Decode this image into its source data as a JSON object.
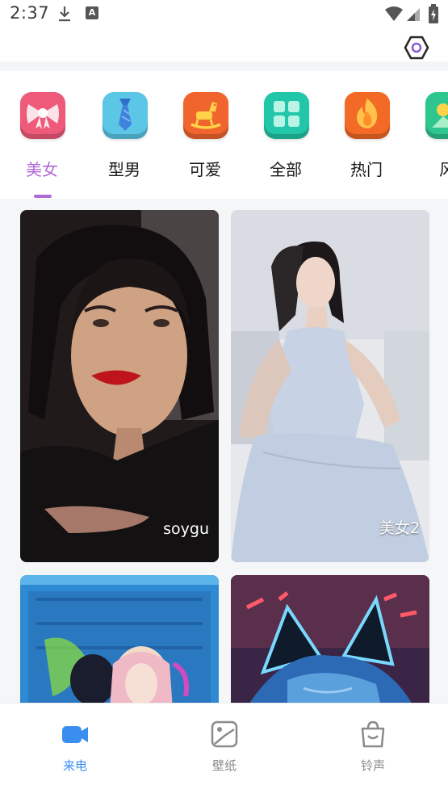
{
  "status_bar": {
    "time": "2:37",
    "icons": [
      "download-icon",
      "a-icon",
      "wifi-icon",
      "signal-icon",
      "battery-icon"
    ]
  },
  "top_bar": {
    "settings_icon": "hexagon-settings-icon"
  },
  "categories": [
    {
      "label": "美女",
      "icon": "bow-icon",
      "color": "#ee5a7a",
      "active": true
    },
    {
      "label": "型男",
      "icon": "tie-icon",
      "color": "#5bc6e6",
      "active": false
    },
    {
      "label": "可爱",
      "icon": "rocking-horse-icon",
      "color": "#f0642d",
      "active": false
    },
    {
      "label": "全部",
      "icon": "grid-icon",
      "color": "#22c6a8",
      "active": false
    },
    {
      "label": "热门",
      "icon": "flame-icon",
      "color": "#f26a26",
      "active": false
    },
    {
      "label": "风",
      "icon": "landscape-icon",
      "color": "#2ec58e",
      "active": false
    }
  ],
  "cards": [
    {
      "label": "soygu",
      "image": "portrait-woman-black-top"
    },
    {
      "label": "美女2",
      "image": "portrait-woman-white-dress"
    },
    {
      "label": "",
      "image": "group-photo-blue-background"
    },
    {
      "label": "",
      "image": "cat-ear-headphones-neon"
    }
  ],
  "bottom_nav": {
    "items": [
      {
        "label": "来电",
        "icon": "video-call-icon",
        "active": true
      },
      {
        "label": "壁纸",
        "icon": "wallpaper-icon",
        "active": false
      },
      {
        "label": "铃声",
        "icon": "shopping-bag-icon",
        "active": false
      }
    ]
  },
  "colors": {
    "accent": "#b06ad8",
    "nav_active": "#3a8ef0",
    "nav_inactive": "#8a8a8a"
  }
}
